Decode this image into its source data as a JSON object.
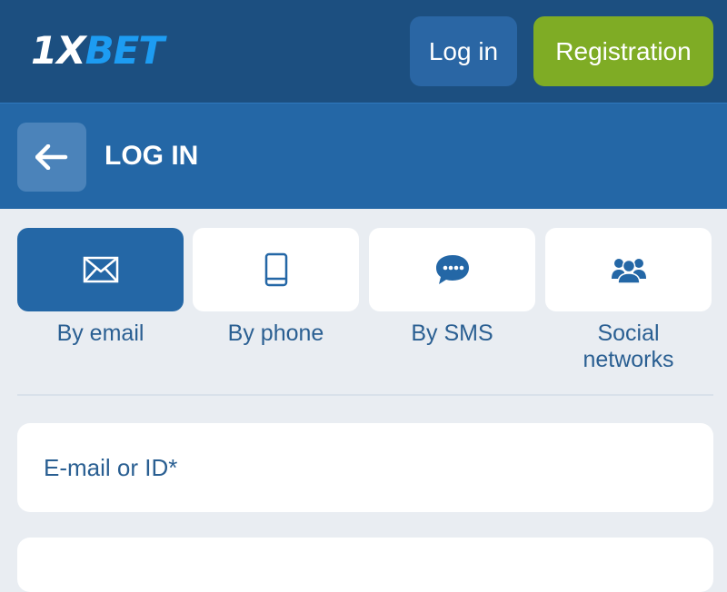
{
  "header": {
    "logo_part1": "1X",
    "logo_part2": "BET",
    "login_label": "Log in",
    "register_label": "Registration"
  },
  "subheader": {
    "title": "LOG IN",
    "back_icon": "arrow-left-icon"
  },
  "login_methods": [
    {
      "label": "By email",
      "icon": "envelope-icon",
      "active": true
    },
    {
      "label": "By phone",
      "icon": "phone-icon",
      "active": false
    },
    {
      "label": "By SMS",
      "icon": "chat-bubble-icon",
      "active": false
    },
    {
      "label": "Social\nnetworks",
      "icon": "users-icon",
      "active": false
    }
  ],
  "form": {
    "email_placeholder": "E-mail or ID*"
  },
  "colors": {
    "header_bg": "#1c4f80",
    "subheader_bg": "#2467a6",
    "register_bg": "#7fac25",
    "accent_blue": "#1d9cf2",
    "page_bg": "#e9edf2"
  }
}
